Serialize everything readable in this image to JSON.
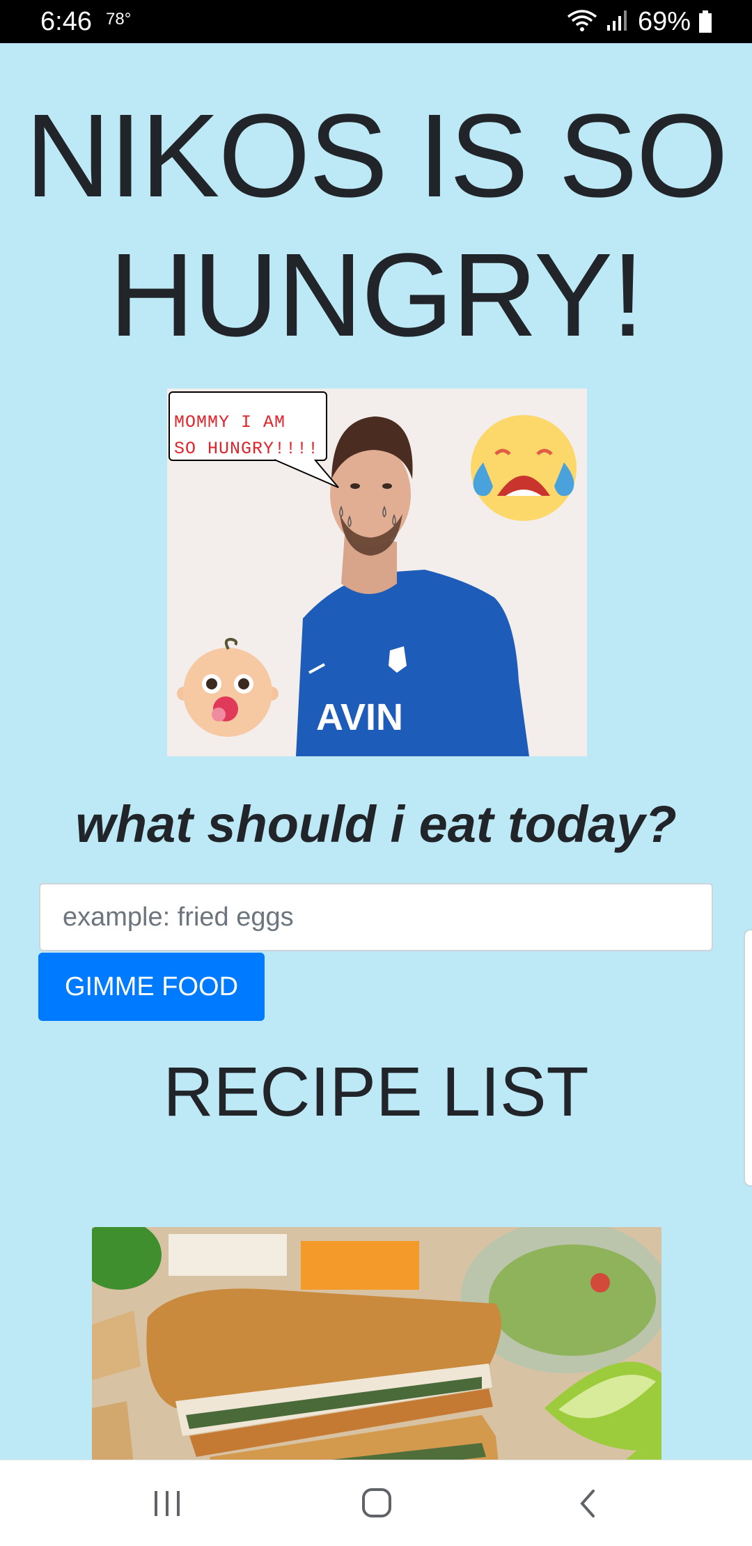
{
  "status_bar": {
    "time": "6:46",
    "temperature": "78°",
    "battery": "69%"
  },
  "page": {
    "title": "NIKOS IS SO HUNGRY!",
    "hero": {
      "speech_bubble": "MOMMY I AM\nSO HUNGRY!!!!",
      "shirt_text": "AVIN",
      "icons": [
        "crying-face-emoji",
        "baby-face-emoji",
        "tears-icon"
      ]
    },
    "subheading": "what should i eat today?",
    "search": {
      "placeholder": "example: fried eggs",
      "value": ""
    },
    "submit_label": "GIMME FOOD",
    "recipe_heading": "RECIPE LIST"
  },
  "nav_bar": {
    "icons": [
      "recent-apps-icon",
      "home-icon",
      "back-icon"
    ]
  },
  "colors": {
    "page_background": "#bde9f6",
    "button": "#007bff",
    "text": "#212529",
    "status_bar": "#000000"
  }
}
